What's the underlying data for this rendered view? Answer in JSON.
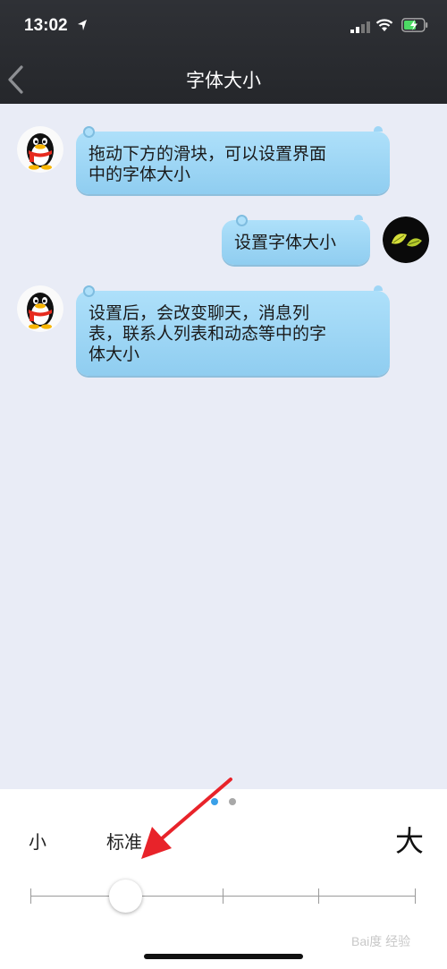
{
  "status_bar": {
    "time": "13:02"
  },
  "nav": {
    "title": "字体大小"
  },
  "messages": [
    {
      "side": "left",
      "text_lines": [
        "拖动下方的滑块，可以设置界面",
        "中的字体大小"
      ]
    },
    {
      "side": "right",
      "text_lines": [
        "设置字体大小"
      ]
    },
    {
      "side": "left",
      "text_lines": [
        "设置后，会改变聊天，消息列",
        "表，联系人列表和动态等中的字",
        "体大小"
      ]
    }
  ],
  "font_size_control": {
    "label_small": "小",
    "label_standard": "标准",
    "label_large": "大",
    "steps": 5,
    "selected_step": 2
  },
  "watermark": "Bai度 经验",
  "colors": {
    "nav_bg": "#2b2d31",
    "chat_bg": "#e9ecf6",
    "bubble": "#9fd6f6",
    "annotation_arrow": "#e8232a"
  }
}
